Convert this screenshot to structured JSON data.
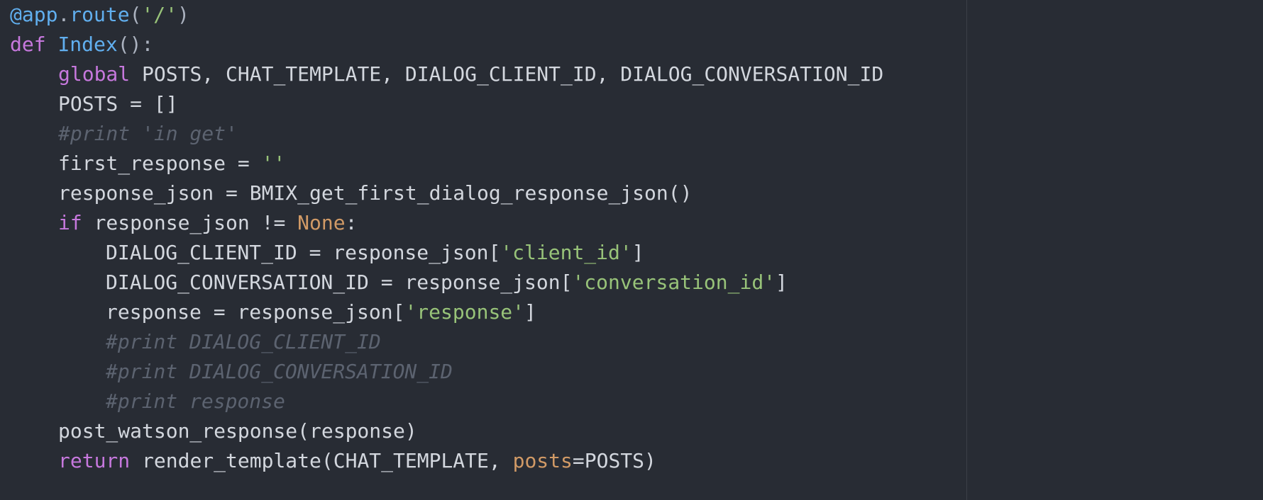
{
  "editor": {
    "theme_colors": {
      "background": "#282c34",
      "text": "#d3d7de",
      "keyword": "#c678dd",
      "function": "#61afef",
      "string": "#98c379",
      "constant": "#d19a66",
      "comment": "#5c6370"
    },
    "lines": [
      {
        "indent": 0,
        "tokens": [
          {
            "t": "@app",
            "c": "fn"
          },
          {
            "t": ".",
            "c": "punct"
          },
          {
            "t": "route",
            "c": "fn"
          },
          {
            "t": "(",
            "c": "punct"
          },
          {
            "t": "'/'",
            "c": "str"
          },
          {
            "t": ")",
            "c": "punct"
          }
        ]
      },
      {
        "indent": 0,
        "tokens": [
          {
            "t": "def",
            "c": "kw"
          },
          {
            "t": " ",
            "c": "default"
          },
          {
            "t": "Index",
            "c": "fn"
          },
          {
            "t": "():",
            "c": "punct"
          }
        ]
      },
      {
        "indent": 1,
        "tokens": [
          {
            "t": "global",
            "c": "kw"
          },
          {
            "t": " POSTS, CHAT_TEMPLATE, DIALOG_CLIENT_ID, DIALOG_CONVERSATION_ID",
            "c": "default"
          }
        ]
      },
      {
        "indent": 1,
        "tokens": [
          {
            "t": "POSTS = []",
            "c": "default"
          }
        ]
      },
      {
        "indent": 1,
        "tokens": [
          {
            "t": "#print 'in get'",
            "c": "comment"
          }
        ]
      },
      {
        "indent": 1,
        "tokens": [
          {
            "t": "first_response = ",
            "c": "default"
          },
          {
            "t": "''",
            "c": "str"
          }
        ]
      },
      {
        "indent": 1,
        "tokens": [
          {
            "t": "response_json = BMIX_get_first_dialog_response_json()",
            "c": "default"
          }
        ]
      },
      {
        "indent": 1,
        "tokens": [
          {
            "t": "if",
            "c": "kw"
          },
          {
            "t": " response_json != ",
            "c": "default"
          },
          {
            "t": "None",
            "c": "const"
          },
          {
            "t": ":",
            "c": "default"
          }
        ]
      },
      {
        "indent": 2,
        "tokens": [
          {
            "t": "DIALOG_CLIENT_ID = response_json[",
            "c": "default"
          },
          {
            "t": "'client_id'",
            "c": "str"
          },
          {
            "t": "]",
            "c": "default"
          }
        ]
      },
      {
        "indent": 2,
        "tokens": [
          {
            "t": "DIALOG_CONVERSATION_ID = response_json[",
            "c": "default"
          },
          {
            "t": "'conversation_id'",
            "c": "str"
          },
          {
            "t": "]",
            "c": "default"
          }
        ]
      },
      {
        "indent": 2,
        "tokens": [
          {
            "t": "response = response_json[",
            "c": "default"
          },
          {
            "t": "'response'",
            "c": "str"
          },
          {
            "t": "]",
            "c": "default"
          }
        ]
      },
      {
        "indent": 2,
        "tokens": [
          {
            "t": "#print DIALOG_CLIENT_ID",
            "c": "comment"
          }
        ]
      },
      {
        "indent": 2,
        "tokens": [
          {
            "t": "#print DIALOG_CONVERSATION_ID",
            "c": "comment"
          }
        ]
      },
      {
        "indent": 2,
        "tokens": [
          {
            "t": "#print response",
            "c": "comment"
          }
        ]
      },
      {
        "indent": 1,
        "tokens": [
          {
            "t": "post_watson_response(response)",
            "c": "default"
          }
        ]
      },
      {
        "indent": 1,
        "tokens": [
          {
            "t": "return",
            "c": "kw"
          },
          {
            "t": " render_template(CHAT_TEMPLATE, ",
            "c": "default"
          },
          {
            "t": "posts",
            "c": "const"
          },
          {
            "t": "=POSTS)",
            "c": "default"
          }
        ]
      }
    ]
  }
}
